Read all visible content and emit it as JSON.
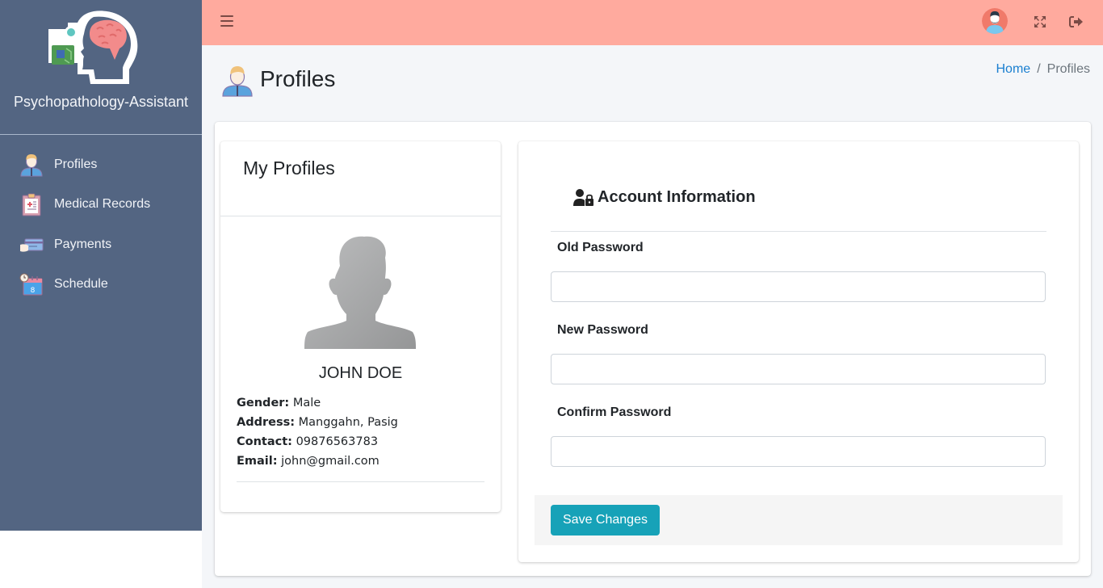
{
  "brand": {
    "name": "Psychopathology-Assistant",
    "logo_icon": "brain-head-logo-icon"
  },
  "sidebar": {
    "items": [
      {
        "label": "Profiles",
        "icon": "user-profile-icon"
      },
      {
        "label": "Medical Records",
        "icon": "clipboard-medical-icon"
      },
      {
        "label": "Payments",
        "icon": "credit-card-hand-icon"
      },
      {
        "label": "Schedule",
        "icon": "calendar-clock-icon"
      }
    ]
  },
  "topbar": {
    "menu_icon": "hamburger-icon",
    "avatar_icon": "user-avatar-icon",
    "fullscreen_icon": "expand-icon",
    "logout_icon": "sign-out-icon",
    "accent_color": "#ffaa9e"
  },
  "page": {
    "title": "Profiles",
    "breadcrumb": {
      "home": "Home",
      "separator": "/",
      "current": "Profiles"
    }
  },
  "profile_card": {
    "title": "My Profiles",
    "name": "JOHN DOE",
    "details": [
      {
        "label": "Gender:",
        "value": "Male"
      },
      {
        "label": "Address:",
        "value": "Manggahn, Pasig"
      },
      {
        "label": "Contact:",
        "value": "09876563783"
      },
      {
        "label": "Email:",
        "value": "john@gmail.com"
      }
    ]
  },
  "account_card": {
    "title": "Account Information",
    "fields": [
      {
        "label": "Old Password",
        "value": "",
        "placeholder": ""
      },
      {
        "label": "New Password",
        "value": "",
        "placeholder": ""
      },
      {
        "label": "Confirm Password",
        "value": "",
        "placeholder": ""
      }
    ],
    "save_label": "Save Changes",
    "button_color": "#17a2b8"
  }
}
